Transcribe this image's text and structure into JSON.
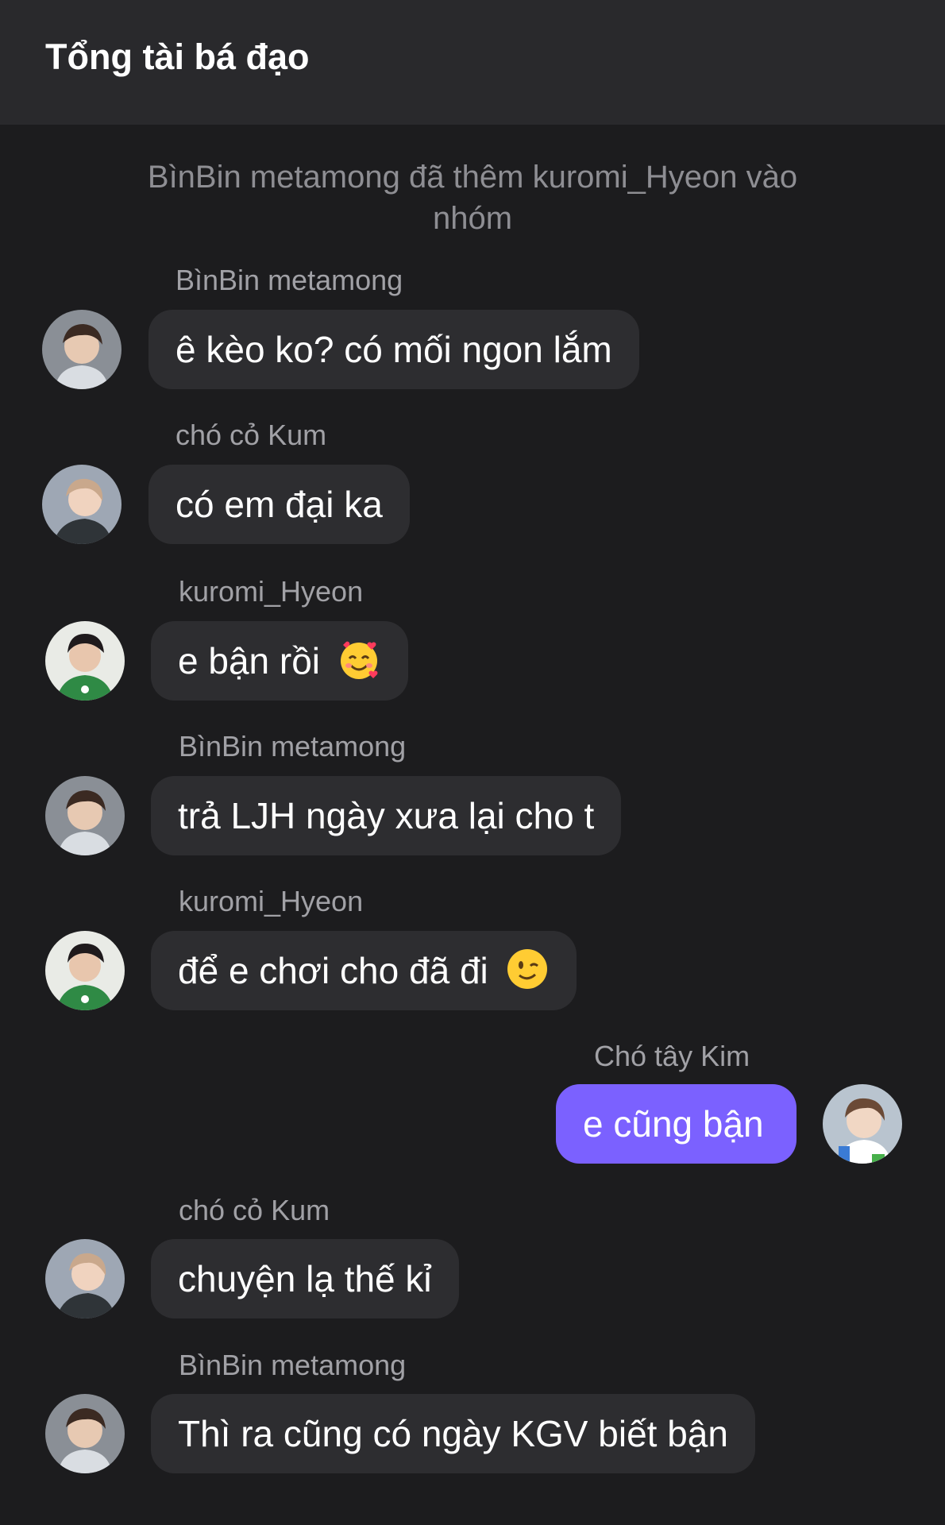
{
  "header": {
    "title": "Tổng tài bá đạo"
  },
  "system_message": "BìnBin metamong đã thêm kuromi_Hyeon vào nhóm",
  "messages": [
    {
      "sender": "BìnBin metamong",
      "text": "ê kèo ko? có mối ngon lắm",
      "avatar": "avatar-binbin"
    },
    {
      "sender": "chó cỏ Kum",
      "text": "có em đại ka",
      "avatar": "avatar-kum"
    },
    {
      "sender": "kuromi_Hyeon",
      "text": "e bận rồi",
      "emoji": "smiling-face-with-hearts-emoji",
      "avatar": "avatar-kuromi"
    },
    {
      "sender": "BìnBin metamong",
      "text": "trả LJH ngày xưa lại cho t",
      "avatar": "avatar-binbin"
    },
    {
      "sender": "kuromi_Hyeon",
      "text": "để e chơi cho đã đi",
      "emoji": "winking-face-emoji",
      "avatar": "avatar-kuromi"
    },
    {
      "sender": "Chó tây Kim",
      "text": "e cũng bận",
      "avatar": "avatar-kim",
      "outgoing": true
    },
    {
      "sender": "chó cỏ Kum",
      "text": "chuyện lạ thế kỉ",
      "avatar": "avatar-kum"
    },
    {
      "sender": "BìnBin metamong",
      "text": "Thì ra cũng có ngày KGV biết bận",
      "avatar": "avatar-binbin"
    }
  ],
  "colors": {
    "background": "#1c1c1e",
    "header": "#29292c",
    "incoming_bubble": "#2d2d30",
    "outgoing_bubble": "#7b61ff"
  }
}
